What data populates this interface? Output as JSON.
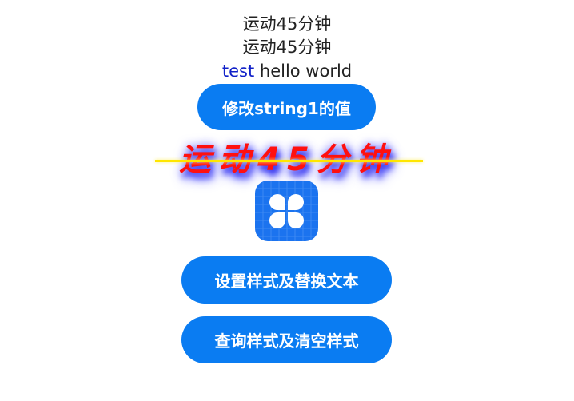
{
  "lines": {
    "line1": "运动45分钟",
    "line2": "运动45分钟",
    "line3_blue": "test",
    "line3_rest": " hello world"
  },
  "buttons": {
    "modify": "修改string1的值",
    "set_style": "设置样式及替换文本",
    "query_style": "查询样式及清空样式"
  },
  "styled_text": "运动45分钟",
  "icon": {
    "name": "flower-icon",
    "background": "#1b73ef"
  },
  "colors": {
    "button_bg": "#0a7cf2",
    "styled_text": "#ff1010",
    "strike": "#ffe600",
    "shadow": "#3333ee",
    "blue_word": "#1020c8"
  }
}
